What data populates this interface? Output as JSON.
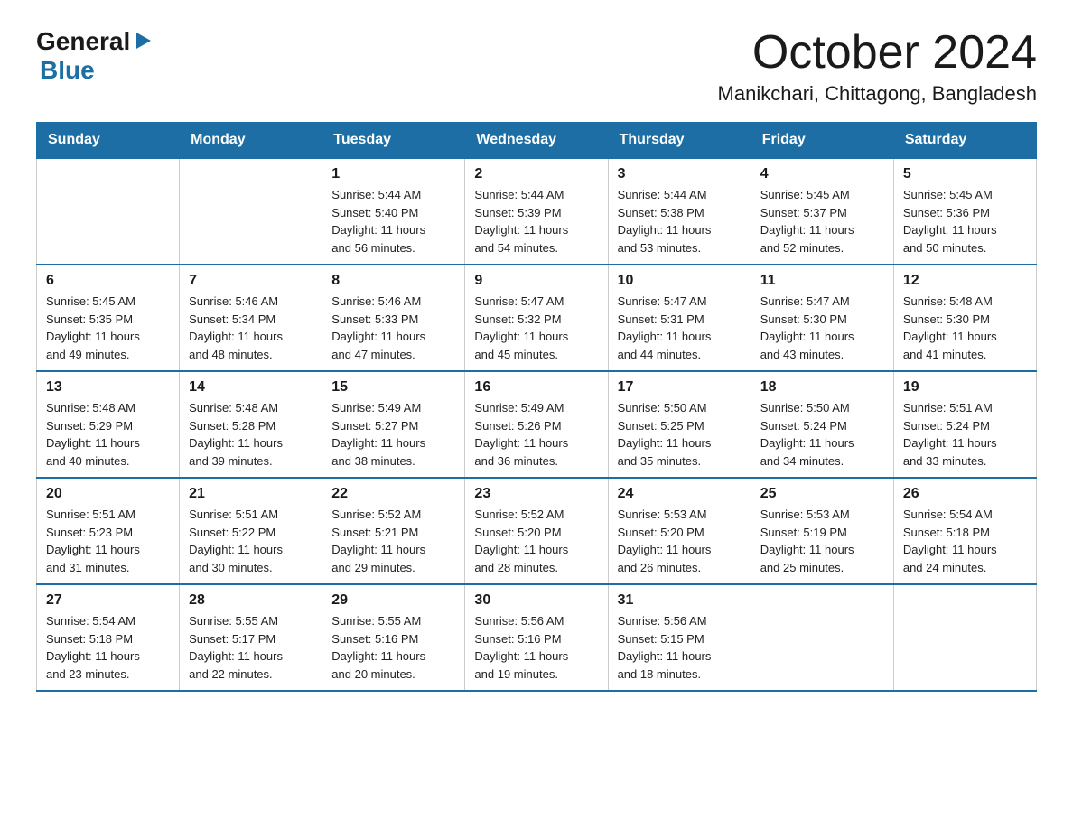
{
  "logo": {
    "general": "General",
    "arrow": "▶",
    "blue": "Blue"
  },
  "title": "October 2024",
  "subtitle": "Manikchari, Chittagong, Bangladesh",
  "days_header": [
    "Sunday",
    "Monday",
    "Tuesday",
    "Wednesday",
    "Thursday",
    "Friday",
    "Saturday"
  ],
  "weeks": [
    [
      {
        "day": "",
        "info": ""
      },
      {
        "day": "",
        "info": ""
      },
      {
        "day": "1",
        "info": "Sunrise: 5:44 AM\nSunset: 5:40 PM\nDaylight: 11 hours\nand 56 minutes."
      },
      {
        "day": "2",
        "info": "Sunrise: 5:44 AM\nSunset: 5:39 PM\nDaylight: 11 hours\nand 54 minutes."
      },
      {
        "day": "3",
        "info": "Sunrise: 5:44 AM\nSunset: 5:38 PM\nDaylight: 11 hours\nand 53 minutes."
      },
      {
        "day": "4",
        "info": "Sunrise: 5:45 AM\nSunset: 5:37 PM\nDaylight: 11 hours\nand 52 minutes."
      },
      {
        "day": "5",
        "info": "Sunrise: 5:45 AM\nSunset: 5:36 PM\nDaylight: 11 hours\nand 50 minutes."
      }
    ],
    [
      {
        "day": "6",
        "info": "Sunrise: 5:45 AM\nSunset: 5:35 PM\nDaylight: 11 hours\nand 49 minutes."
      },
      {
        "day": "7",
        "info": "Sunrise: 5:46 AM\nSunset: 5:34 PM\nDaylight: 11 hours\nand 48 minutes."
      },
      {
        "day": "8",
        "info": "Sunrise: 5:46 AM\nSunset: 5:33 PM\nDaylight: 11 hours\nand 47 minutes."
      },
      {
        "day": "9",
        "info": "Sunrise: 5:47 AM\nSunset: 5:32 PM\nDaylight: 11 hours\nand 45 minutes."
      },
      {
        "day": "10",
        "info": "Sunrise: 5:47 AM\nSunset: 5:31 PM\nDaylight: 11 hours\nand 44 minutes."
      },
      {
        "day": "11",
        "info": "Sunrise: 5:47 AM\nSunset: 5:30 PM\nDaylight: 11 hours\nand 43 minutes."
      },
      {
        "day": "12",
        "info": "Sunrise: 5:48 AM\nSunset: 5:30 PM\nDaylight: 11 hours\nand 41 minutes."
      }
    ],
    [
      {
        "day": "13",
        "info": "Sunrise: 5:48 AM\nSunset: 5:29 PM\nDaylight: 11 hours\nand 40 minutes."
      },
      {
        "day": "14",
        "info": "Sunrise: 5:48 AM\nSunset: 5:28 PM\nDaylight: 11 hours\nand 39 minutes."
      },
      {
        "day": "15",
        "info": "Sunrise: 5:49 AM\nSunset: 5:27 PM\nDaylight: 11 hours\nand 38 minutes."
      },
      {
        "day": "16",
        "info": "Sunrise: 5:49 AM\nSunset: 5:26 PM\nDaylight: 11 hours\nand 36 minutes."
      },
      {
        "day": "17",
        "info": "Sunrise: 5:50 AM\nSunset: 5:25 PM\nDaylight: 11 hours\nand 35 minutes."
      },
      {
        "day": "18",
        "info": "Sunrise: 5:50 AM\nSunset: 5:24 PM\nDaylight: 11 hours\nand 34 minutes."
      },
      {
        "day": "19",
        "info": "Sunrise: 5:51 AM\nSunset: 5:24 PM\nDaylight: 11 hours\nand 33 minutes."
      }
    ],
    [
      {
        "day": "20",
        "info": "Sunrise: 5:51 AM\nSunset: 5:23 PM\nDaylight: 11 hours\nand 31 minutes."
      },
      {
        "day": "21",
        "info": "Sunrise: 5:51 AM\nSunset: 5:22 PM\nDaylight: 11 hours\nand 30 minutes."
      },
      {
        "day": "22",
        "info": "Sunrise: 5:52 AM\nSunset: 5:21 PM\nDaylight: 11 hours\nand 29 minutes."
      },
      {
        "day": "23",
        "info": "Sunrise: 5:52 AM\nSunset: 5:20 PM\nDaylight: 11 hours\nand 28 minutes."
      },
      {
        "day": "24",
        "info": "Sunrise: 5:53 AM\nSunset: 5:20 PM\nDaylight: 11 hours\nand 26 minutes."
      },
      {
        "day": "25",
        "info": "Sunrise: 5:53 AM\nSunset: 5:19 PM\nDaylight: 11 hours\nand 25 minutes."
      },
      {
        "day": "26",
        "info": "Sunrise: 5:54 AM\nSunset: 5:18 PM\nDaylight: 11 hours\nand 24 minutes."
      }
    ],
    [
      {
        "day": "27",
        "info": "Sunrise: 5:54 AM\nSunset: 5:18 PM\nDaylight: 11 hours\nand 23 minutes."
      },
      {
        "day": "28",
        "info": "Sunrise: 5:55 AM\nSunset: 5:17 PM\nDaylight: 11 hours\nand 22 minutes."
      },
      {
        "day": "29",
        "info": "Sunrise: 5:55 AM\nSunset: 5:16 PM\nDaylight: 11 hours\nand 20 minutes."
      },
      {
        "day": "30",
        "info": "Sunrise: 5:56 AM\nSunset: 5:16 PM\nDaylight: 11 hours\nand 19 minutes."
      },
      {
        "day": "31",
        "info": "Sunrise: 5:56 AM\nSunset: 5:15 PM\nDaylight: 11 hours\nand 18 minutes."
      },
      {
        "day": "",
        "info": ""
      },
      {
        "day": "",
        "info": ""
      }
    ]
  ]
}
